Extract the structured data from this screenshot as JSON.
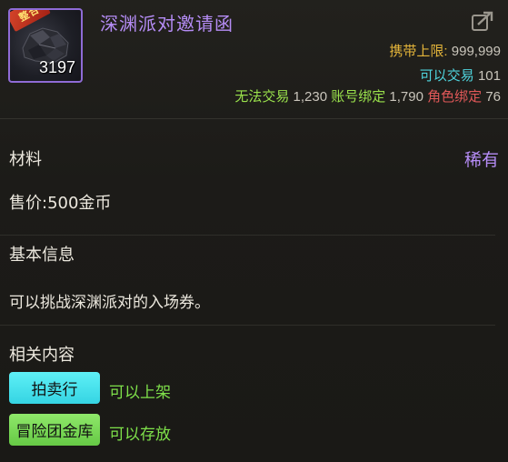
{
  "item": {
    "name": "深渊派对邀请函",
    "count": "3197",
    "tag": "整合",
    "frame_color": "#8f6bd6",
    "name_color": "#b58cf5"
  },
  "header": {
    "carry_limit_label": "携带上限:",
    "carry_limit_value": "999,999",
    "tradable_label": "可以交易",
    "tradable_value": "101",
    "untradable_label": "无法交易",
    "untradable_value": "1,230",
    "account_bound_label": "账号绑定",
    "account_bound_value": "1,790",
    "char_bound_label": "角色绑定",
    "char_bound_value": "76",
    "share_icon": "share-export-icon"
  },
  "details": {
    "category": "材料",
    "rarity": "稀有",
    "price": "售价:500金币",
    "basic_info_title": "基本信息",
    "description": "可以挑战深渊派对的入场券。",
    "related_title": "相关内容"
  },
  "related": [
    {
      "button": "拍卖行",
      "note": "可以上架",
      "color": "#35d4e3"
    },
    {
      "button": "冒险团金库",
      "note": "可以存放",
      "color": "#66c945"
    }
  ]
}
